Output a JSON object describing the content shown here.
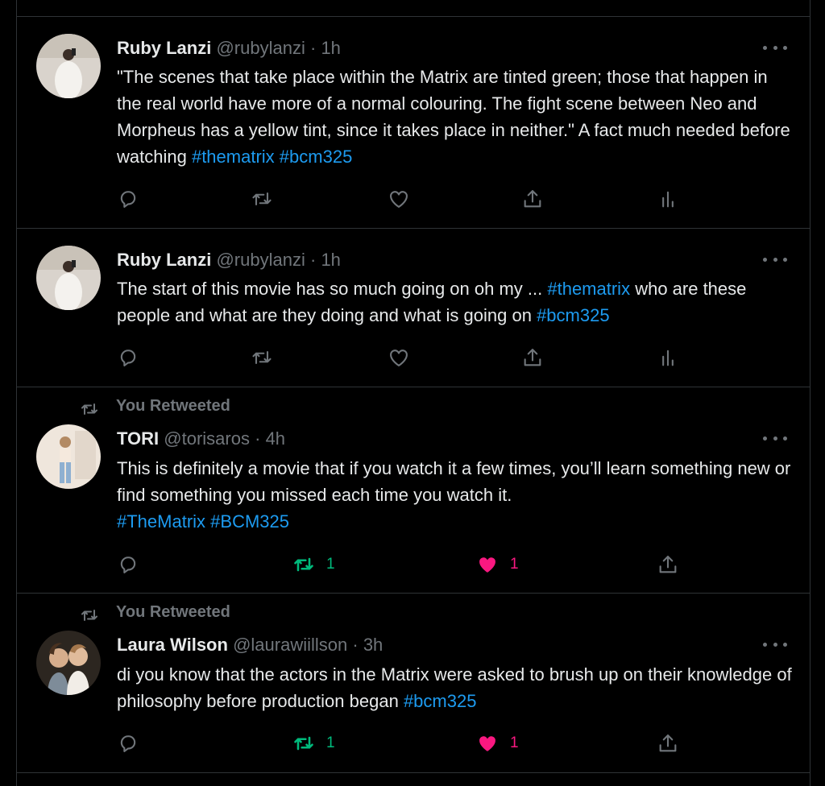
{
  "tweets": [
    {
      "name": "Ruby Lanzi",
      "handle": "@rubylanzi",
      "separator": "·",
      "time": "1h",
      "text_before": "\"The scenes that take place within the Matrix are tinted green; those that happen in the real world have more of a normal colouring. The fight scene between Neo and Morpheus has a yellow tint, since it takes place in neither.\" A fact much needed before watching ",
      "hashtag1": "#thematrix",
      "hashtag2": "#bcm325"
    },
    {
      "name": "Ruby Lanzi",
      "handle": "@rubylanzi",
      "separator": "·",
      "time": "1h",
      "text_before": "The start of this movie has so much going on oh my ... ",
      "hashtag1": "#thematrix",
      "text_middle": " who are these people and what are they doing and what is going on ",
      "hashtag2": "#bcm325"
    },
    {
      "retweet_label": "You Retweeted",
      "name": "TORI",
      "handle": "@torisaros",
      "separator": "·",
      "time": "4h",
      "text_before": "This is definitely a movie that if you watch it a few times, you’ll learn something new or find something you missed each time you watch it.",
      "hashtag1": "#TheMatrix",
      "hashtag2": "#BCM325",
      "retweet_count": "1",
      "like_count": "1"
    },
    {
      "retweet_label": "You Retweeted",
      "name": "Laura Wilson",
      "handle": "@laurawiillson",
      "separator": "·",
      "time": "3h",
      "text_before": "di you know that the actors in the Matrix were asked to brush up on their knowledge of philosophy before production began ",
      "hashtag1": "#bcm325",
      "retweet_count": "1",
      "like_count": "1"
    }
  ],
  "colors": {
    "background": "#000000",
    "text": "#e7e9ea",
    "muted": "#71767b",
    "link": "#1d9bf0",
    "retweeted": "#00ba7c",
    "liked": "#f91880",
    "divider": "#2f3336"
  },
  "icons": [
    "reply-icon",
    "retweet-icon",
    "like-icon",
    "share-icon",
    "analytics-icon",
    "more-icon"
  ]
}
